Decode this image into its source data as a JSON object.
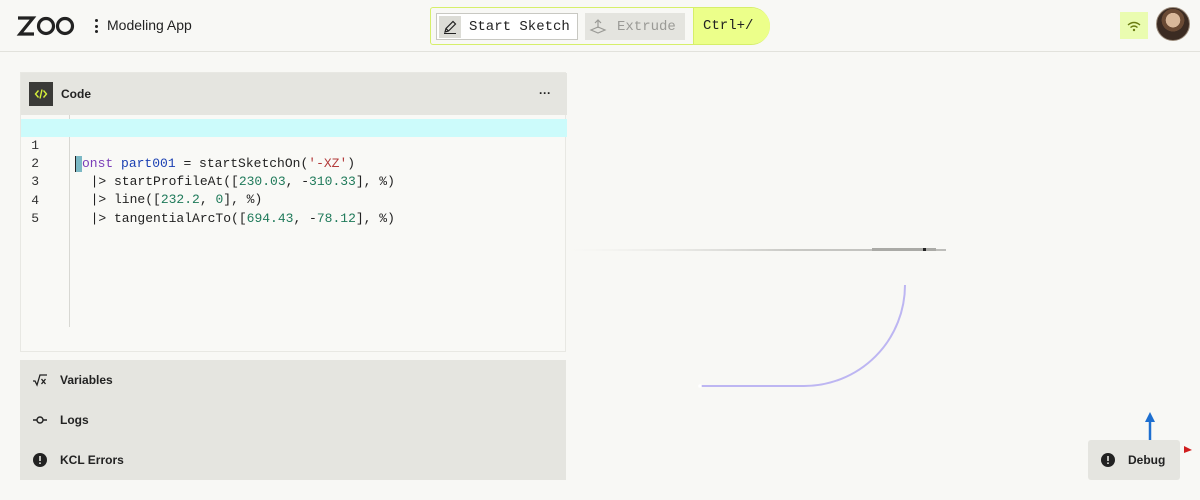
{
  "header": {
    "logo_text": "ZOO",
    "app_name": "Modeling App"
  },
  "toolbar": {
    "start_sketch_label": "Start Sketch",
    "extrude_label": "Extrude",
    "shortcut_label": "Ctrl+/"
  },
  "code_pane": {
    "title": "Code",
    "more_label": "···",
    "lines": [
      {
        "number": "1"
      },
      {
        "number": "2"
      },
      {
        "number": "3"
      },
      {
        "number": "4"
      },
      {
        "number": "5"
      }
    ],
    "line1": {
      "kw": "onst",
      "var": "part001",
      "op": " = startSketchOn(",
      "str": "'-XZ'",
      "close": ")"
    },
    "line2": {
      "pre": "  |> startProfileAt([",
      "n1": "230.03",
      "mid": ", -",
      "n2": "310.33",
      "post": "], %)"
    },
    "line3": {
      "pre": "  |> line([",
      "n1": "232.2",
      "mid": ", ",
      "n2": "0",
      "post": "], %)"
    },
    "line4": {
      "pre": "  |> tangentialArcTo([",
      "n1": "694.43",
      "mid": ", -",
      "n2": "78.12",
      "post": "], %)"
    }
  },
  "lower_panes": {
    "variables_label": "Variables",
    "logs_label": "Logs",
    "kcl_errors_label": "KCL Errors"
  },
  "debug_label": "Debug",
  "icons": {
    "code": "code-icon",
    "variables": "sqrt-x-icon",
    "logs": "commit-icon",
    "errors": "alert-circle-icon",
    "network": "wifi-icon",
    "sketch": "pencil-icon",
    "extrude": "extrude-icon"
  },
  "colors": {
    "accent": "#ecff8a",
    "active_line": "#ccfbfb",
    "sketch_curve": "#bdb6f2",
    "axis_blue": "#1e6fd0",
    "axis_red": "#d01e1e"
  }
}
